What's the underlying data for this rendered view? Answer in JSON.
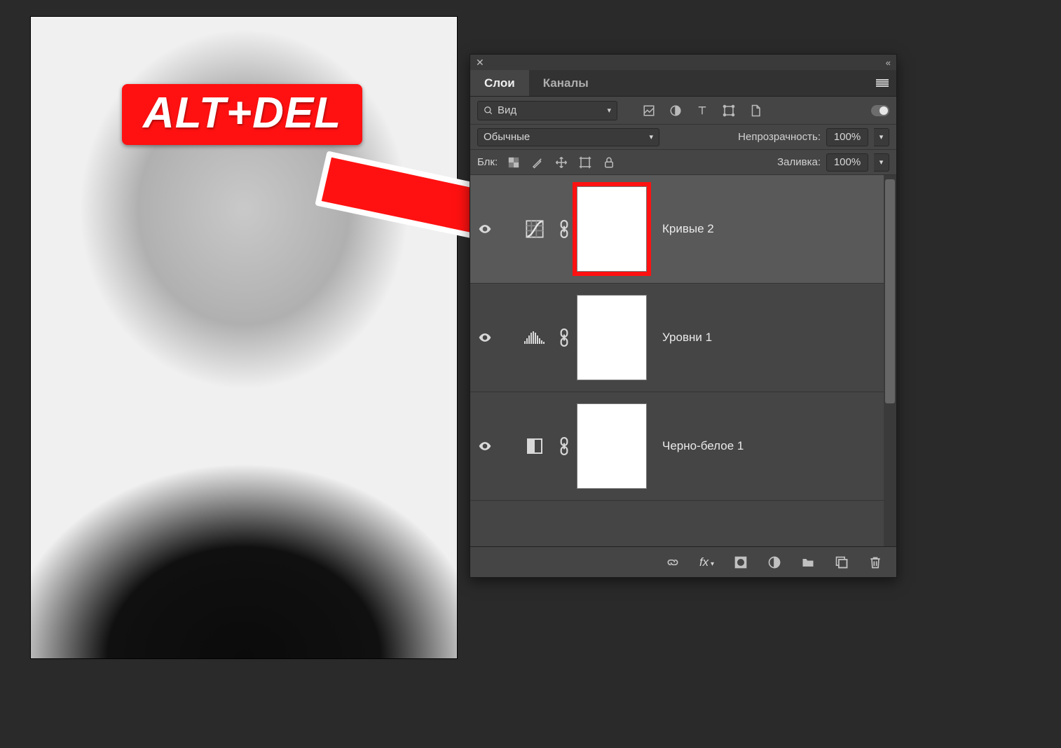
{
  "badge": {
    "text": "ALT+DEL"
  },
  "panel": {
    "tabs": {
      "layers": "Слои",
      "channels": "Каналы"
    },
    "search_label": "Вид",
    "blend_mode": "Обычные",
    "opacity_label": "Непрозрачность:",
    "opacity_value": "100%",
    "lock_label": "Блк:",
    "fill_label": "Заливка:",
    "fill_value": "100%"
  },
  "layers": [
    {
      "name": "Кривые 2",
      "kind": "curves",
      "selected": true,
      "highlighted_mask": true
    },
    {
      "name": "Уровни 1",
      "kind": "levels",
      "selected": false,
      "highlighted_mask": false
    },
    {
      "name": "Черно-белое 1",
      "kind": "bw",
      "selected": false,
      "highlighted_mask": false
    }
  ],
  "bottom_icons": [
    "link",
    "fx",
    "mask",
    "adjust",
    "group",
    "new",
    "trash"
  ],
  "colors": {
    "accent_red": "#ff1111"
  }
}
